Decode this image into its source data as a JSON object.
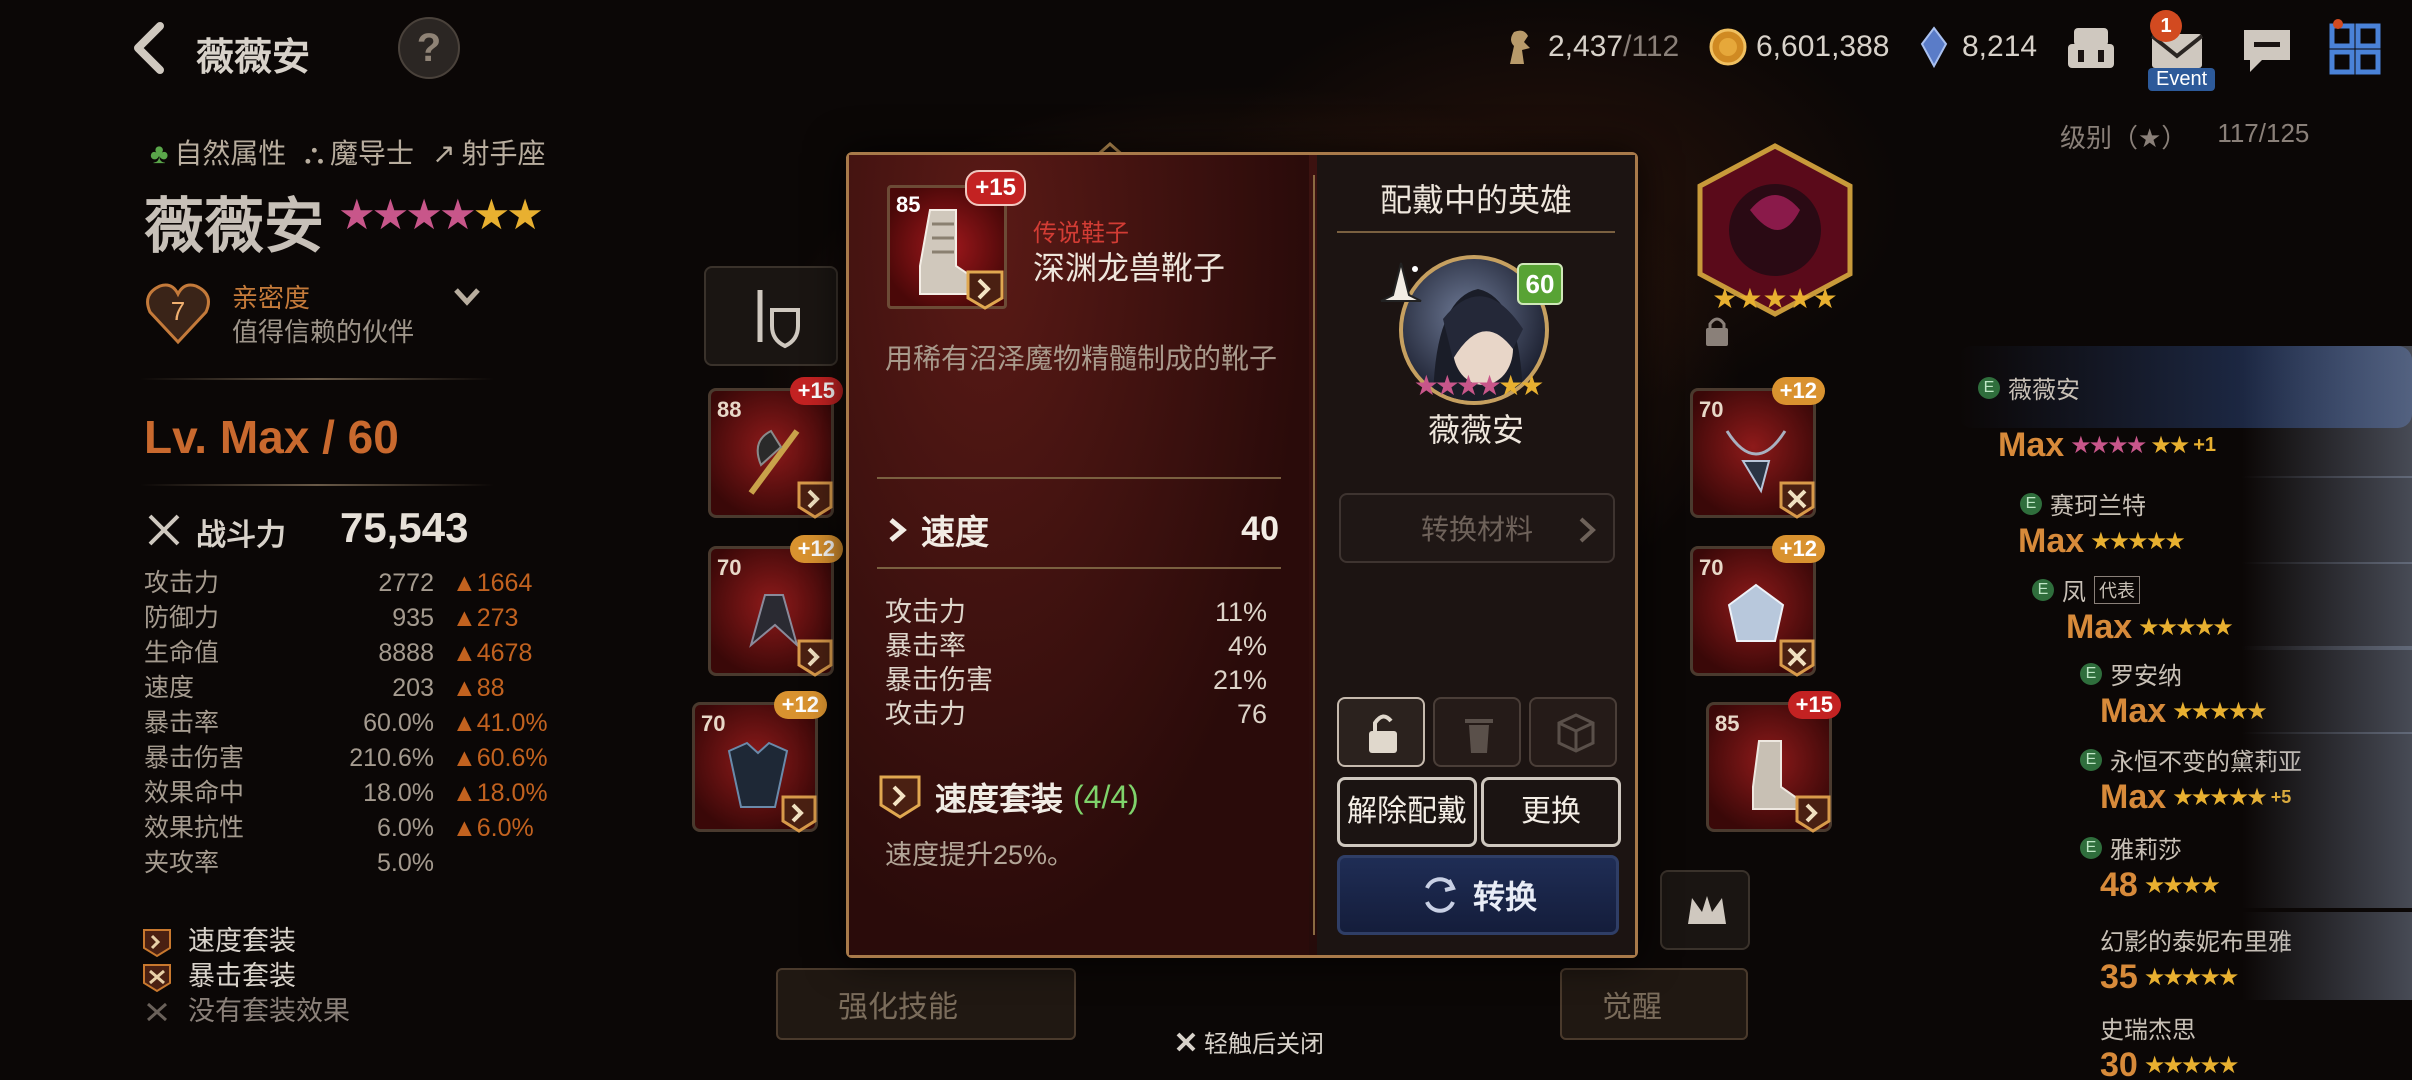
{
  "top_bar": {
    "hero_name": "薇薇安",
    "help_label": "?",
    "currencies": [
      {
        "icon": "stamina-icon",
        "value": "2,437",
        "sub": "/112"
      },
      {
        "icon": "gold-icon",
        "value": "6,601,388",
        "sub": ""
      },
      {
        "icon": "crystal-icon",
        "value": "8,214",
        "sub": ""
      }
    ],
    "mail_badge": "1",
    "event_label": "Event"
  },
  "sort": {
    "label": "级别（★）",
    "count": "117/125"
  },
  "hero": {
    "attributes": [
      "自然属性",
      "魔导士",
      "射手座"
    ],
    "name": "薇薇安",
    "stars": "★★★★★★",
    "affinity_level": "7",
    "affinity_title": "亲密度",
    "affinity_desc": "值得信赖的伙伴",
    "level": "Lv. Max / 60",
    "combat_label": "战斗力",
    "combat_value": "75,543",
    "stats": [
      {
        "name": "攻击力",
        "value": "2772",
        "bonus": "1664"
      },
      {
        "name": "防御力",
        "value": "935",
        "bonus": "273"
      },
      {
        "name": "生命值",
        "value": "8888",
        "bonus": "4678"
      },
      {
        "name": "速度",
        "value": "203",
        "bonus": "88"
      },
      {
        "name": "暴击率",
        "value": "60.0%",
        "bonus": "41.0%"
      },
      {
        "name": "暴击伤害",
        "value": "210.6%",
        "bonus": "60.6%"
      },
      {
        "name": "效果命中",
        "value": "18.0%",
        "bonus": "18.0%"
      },
      {
        "name": "效果抗性",
        "value": "6.0%",
        "bonus": "6.0%"
      },
      {
        "name": "夹攻率",
        "value": "5.0%",
        "bonus": ""
      }
    ],
    "sets": [
      {
        "label": "速度套装",
        "dim": false
      },
      {
        "label": "暴击套装",
        "dim": false
      },
      {
        "label": "没有套装效果",
        "dim": true
      }
    ]
  },
  "equipment_slots": [
    {
      "level": "88",
      "plus": "+15",
      "red": true
    },
    {
      "level": "70",
      "plus": "+12",
      "red": false
    },
    {
      "level": "70",
      "plus": "+12",
      "red": false
    },
    {
      "level": "70",
      "plus": "+12",
      "red": false
    },
    {
      "level": "70",
      "plus": "+12",
      "red": false
    },
    {
      "level": "85",
      "plus": "+15",
      "red": true
    }
  ],
  "bottom_buttons": {
    "enhance_skill": "强化技能",
    "awaken": "觉醒"
  },
  "hero_list": [
    {
      "name": "薇薇安",
      "level": "Max",
      "extra": "+1"
    },
    {
      "name": "赛珂兰特",
      "level": "Max",
      "extra": ""
    },
    {
      "name": "凤",
      "level": "Max",
      "extra": "代表"
    },
    {
      "name": "罗安纳",
      "level": "Max",
      "extra": ""
    },
    {
      "name": "永恒不变的黛莉亚",
      "level": "Max",
      "extra": "+5"
    },
    {
      "name": "雅莉莎",
      "level": "48",
      "extra": ""
    },
    {
      "name": "幻影的泰妮布里雅",
      "level": "35",
      "extra": ""
    },
    {
      "name": "史瑞杰思",
      "level": "30",
      "extra": ""
    }
  ],
  "modal": {
    "item": {
      "level": "85",
      "plus": "+15",
      "grade": "传说鞋子",
      "name": "深渊龙兽靴子",
      "description": "用稀有沼泽魔物精髓制成的靴子"
    },
    "main_stat": {
      "name": "速度",
      "value": "40"
    },
    "sub_stats": [
      {
        "name": "攻击力",
        "value": "11%"
      },
      {
        "name": "暴击率",
        "value": "4%"
      },
      {
        "name": "暴击伤害",
        "value": "21%"
      },
      {
        "name": "攻击力",
        "value": "76"
      }
    ],
    "set": {
      "name": "速度套装",
      "count": "(4/4)",
      "effect": "速度提升25%。"
    },
    "equipped_title": "配戴中的英雄",
    "equipped_hero": {
      "name": "薇薇安",
      "level": "60",
      "stars": "★★★★★★"
    },
    "convert_material": "转换材料",
    "unequip": "解除配戴",
    "replace": "更换",
    "transform": "转换"
  },
  "close_hint": "轻触后关闭",
  "colors": {
    "accent_orange": "#c9692e",
    "legend_red": "#d23c34",
    "set_count_green": "#7fd36b"
  }
}
